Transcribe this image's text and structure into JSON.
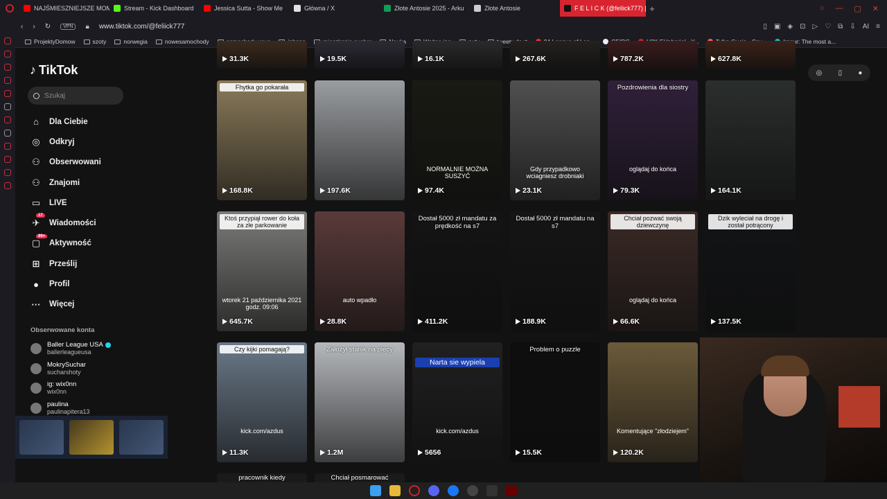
{
  "browser": {
    "tabs": [
      {
        "label": "NAJŚMIESZNIEJSZE MOM",
        "color": "#ff0000"
      },
      {
        "label": "Stream - Kick Dashboard",
        "color": "#53fc18"
      },
      {
        "label": "Jessica Sutta - Show Me",
        "color": "#ff0000"
      },
      {
        "label": "Główna / X",
        "color": "#e0e0e0"
      },
      {
        "label": "Złote Antosie 2025 - Arku",
        "color": "#0f9d58"
      },
      {
        "label": "Złote Antosie",
        "color": "#cccccc"
      }
    ],
    "active_tab": "F E L I C K (@feliick777) |",
    "vpn_label": "VPN",
    "url": "www.tiktok.com/@feliick777",
    "ai_label": "AI",
    "bookmarks": [
      "ProjektyDomow",
      "szoty",
      "norwegia",
      "nowesamochody",
      "samochody xayo",
      "iphone",
      "mieszkania suchar",
      "Nauka",
      "Ważne jpg",
      "nuty",
      "tweety do rt",
      "94 League of Leg...",
      "CEIDG",
      "H2K EUphoria! - Y...",
      "Tylko Gucio - Cov...",
      "Imgur: The most a..."
    ]
  },
  "sidebar": {
    "logo": "TikTok",
    "search_placeholder": "Szukaj",
    "nav": [
      {
        "label": "Dla Ciebie",
        "icon": "home-icon",
        "glyph": "⌂"
      },
      {
        "label": "Odkryj",
        "icon": "compass-icon",
        "glyph": "◎"
      },
      {
        "label": "Obserwowani",
        "icon": "following-icon",
        "glyph": "⚇"
      },
      {
        "label": "Znajomi",
        "icon": "friends-icon",
        "glyph": "⚇"
      },
      {
        "label": "LIVE",
        "icon": "live-icon",
        "glyph": "▭"
      },
      {
        "label": "Wiadomości",
        "icon": "messages-icon",
        "glyph": "✈",
        "badge": "17"
      },
      {
        "label": "Aktywność",
        "icon": "activity-icon",
        "glyph": "▢",
        "badge": "99+"
      },
      {
        "label": "Prześlij",
        "icon": "upload-icon",
        "glyph": "⊞"
      },
      {
        "label": "Profil",
        "icon": "profile-icon",
        "glyph": "●"
      },
      {
        "label": "Więcej",
        "icon": "more-icon",
        "glyph": "···"
      }
    ],
    "following_title": "Obserwowane konta",
    "following": [
      {
        "name": "Baller League USA",
        "handle": "ballerleagueusa",
        "verified": true
      },
      {
        "name": "MokrySuchar",
        "handle": "sucharshoty",
        "verified": false
      },
      {
        "name": "ig: wix0nn",
        "handle": "wix0nn",
        "verified": false
      },
      {
        "name": "paulina",
        "handle": "paulinapitera13",
        "verified": false
      }
    ]
  },
  "grid": {
    "rows": [
      [
        {
          "views": "31.3K",
          "caption": "",
          "bg": "#3b2a1e"
        },
        {
          "views": "19.5K",
          "caption": "",
          "bg": "#2d2a35"
        },
        {
          "views": "16.1K",
          "caption": "",
          "bg": "#2a2a2a"
        },
        {
          "views": "267.6K",
          "caption": "",
          "bg": "#24211f"
        },
        {
          "views": "787.2K",
          "caption": "",
          "bg": "#3a1c1c"
        },
        {
          "views": "627.8K",
          "caption": "",
          "bg": "#3a2218"
        }
      ],
      [
        {
          "views": "168.8K",
          "caption": "Fhytka go pokarała",
          "bg": "#8a7a5a",
          "style": "light"
        },
        {
          "views": "197.6K",
          "caption": "",
          "bg": "#9a9da0"
        },
        {
          "views": "97.4K",
          "caption": "",
          "mid": "NORMALNIE MOŻNA SUSZYĆ",
          "bg": "#1a1a14"
        },
        {
          "views": "23.1K",
          "caption": "",
          "mid": "Gdy przypadkowo wciagniesz drobniaki",
          "bg": "#505050"
        },
        {
          "views": "79.3K",
          "caption": "Pozdrowienia dla siostry",
          "bg": "#30203a",
          "style": "dark",
          "mid": "oglądaj do końca"
        },
        {
          "views": "164.1K",
          "caption": "",
          "bg": "#2a2e2c"
        }
      ],
      [
        {
          "views": "645.7K",
          "caption": "Ktoś przypiął rower do koła za złe parkowanie",
          "bg": "#7a7a78",
          "style": "light",
          "mid": "wtorek 21 października 2021 godz. 09:06"
        },
        {
          "views": "28.8K",
          "caption": "",
          "bg": "#5a3a3a",
          "mid": "auto wpadło"
        },
        {
          "views": "411.2K",
          "caption": "Dostał 5000 zł mandatu za prędkość na s7",
          "bg": "#141414",
          "style": "dark"
        },
        {
          "views": "188.9K",
          "caption": "Dostał 5000 zł mandatu na s7",
          "bg": "#151515",
          "style": "dark"
        },
        {
          "views": "66.6K",
          "caption": "Chciał pozwać swoją dziewczynę",
          "bg": "#3a2a26",
          "style": "light",
          "mid": "oglądaj do końca"
        },
        {
          "views": "137.5K",
          "caption": "Dzik wyleciał na drogę i został potrącony",
          "bg": "#121416",
          "style": "light"
        }
      ],
      [
        {
          "views": "11.3K",
          "caption": "Czy kijki pomagają?",
          "bg": "#6a7888",
          "style": "light",
          "mid": "kick.com/azdus"
        },
        {
          "views": "1.2M",
          "caption": "Założył stanik na plecy",
          "bg": "#b5b8bc",
          "style": "dark"
        },
        {
          "views": "5656",
          "caption": "Narta sie wypiela",
          "bg": "#202020",
          "style": "blue",
          "mid": "kick.com/azdus"
        },
        {
          "views": "15.5K",
          "caption": "Problem o puzzle",
          "bg": "#0e0e0e",
          "style": "dark"
        },
        {
          "views": "120.2K",
          "caption": "",
          "bg": "#6b5a3a",
          "mid": "Komentujące \"złodziejem\""
        },
        {
          "views": "",
          "caption": "",
          "bg": "#121212"
        }
      ]
    ],
    "next_row_captions": [
      "pracownik kiedy",
      "Chciał posmarować"
    ]
  },
  "taskbar_icons": [
    "windows-start",
    "file-explorer",
    "opera",
    "discord",
    "facebook",
    "steam",
    "terminal",
    "app"
  ]
}
